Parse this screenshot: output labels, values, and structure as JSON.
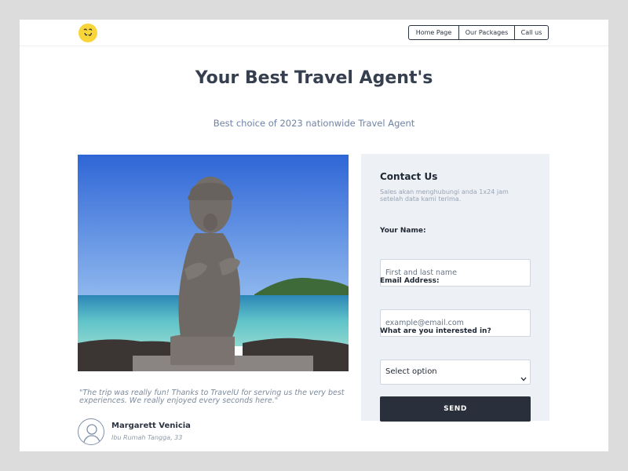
{
  "nav": {
    "items": [
      {
        "label": "Home Page"
      },
      {
        "label": "Our Packages"
      },
      {
        "label": "Call us"
      }
    ]
  },
  "hero": {
    "title": "Your Best Travel Agent's",
    "subtitle": "Best choice of 2023 nationwide Travel Agent"
  },
  "testimonial": {
    "quote": "\"The trip was really fun! Thanks to TravelU for serving us the very best experiences. We really enjoyed every seconds here.\"",
    "name": "Margarett Venicia",
    "role": "Ibu Rumah Tangga, 33"
  },
  "contact": {
    "title": "Contact Us",
    "description": "Sales akan menghubungi anda 1x24 jam setelah data kami terima.",
    "name_label": "Your Name:",
    "name_placeholder": "First and last name",
    "email_label": "Email Address:",
    "email_placeholder": "example@email.com",
    "interest_label": "What are you interested in?",
    "interest_selected": "Select option",
    "send_label": "SEND"
  },
  "colors": {
    "logo": "#f8d63a",
    "accent_dark": "#2a303b",
    "subtitle": "#6f83a6",
    "contact_bg": "#edf0f4"
  },
  "icons": {
    "logo": "smiley-logo-icon",
    "avatar": "user-avatar-icon",
    "select": "chevron-down-icon"
  }
}
